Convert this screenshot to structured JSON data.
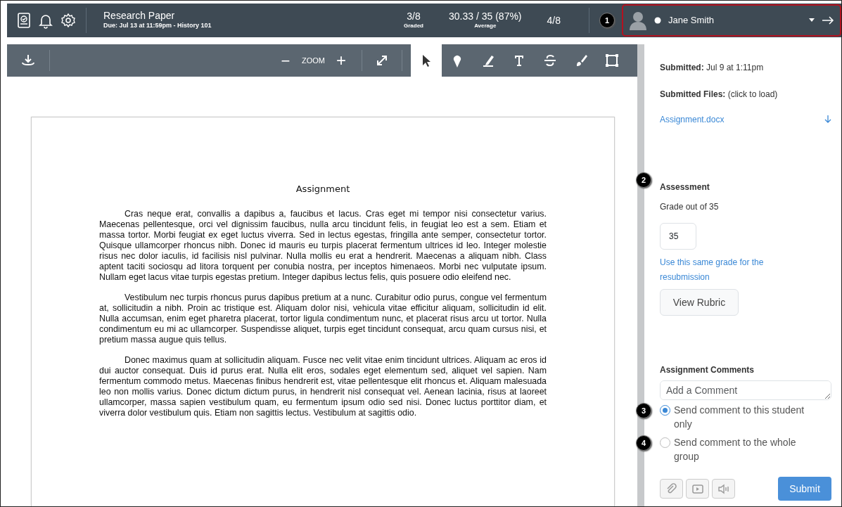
{
  "header": {
    "title": "Research Paper",
    "subtitle": "Due: Jul 13 at 11:59pm - History 101",
    "stats": [
      {
        "value": "3/8",
        "label": "Graded"
      },
      {
        "value": "30.33 / 35 (87%)",
        "label": "Average"
      },
      {
        "value": "4/8"
      }
    ],
    "student": {
      "name": "Jane Smith",
      "callout": "1"
    }
  },
  "toolbar": {
    "zoom_label": "ZOOM",
    "zoom_out": "−",
    "zoom_in": "+",
    "tools": [
      {
        "kind": "pointer",
        "selected": true
      },
      {
        "kind": "pin",
        "selected": false
      },
      {
        "kind": "highlight",
        "selected": false
      },
      {
        "kind": "text",
        "selected": false
      },
      {
        "kind": "strike",
        "selected": false
      },
      {
        "kind": "brush",
        "selected": false
      },
      {
        "kind": "box",
        "selected": false
      }
    ]
  },
  "document": {
    "heading": "Assignment",
    "paragraphs": [
      "Cras neque erat, convallis a dapibus a, faucibus et lacus. Cras eget mi tempor nisi consectetur varius. Maecenas pellentesque, orci vel dignissim faucibus, nulla arcu tincidunt felis, in feugiat leo est a sem. Etiam et massa tortor. Morbi feugiat ex eget luctus viverra. Sed in lectus egestas, fringilla ante semper, consectetur tortor. Quisque ullamcorper rhoncus nibh. Donec id mauris eu turpis placerat fermentum ultrices id leo. Integer molestie risus nec dolor iaculis, id facilisis nisl pulvinar. Nulla mollis eu erat a hendrerit. Maecenas a aliquam nibh. Class aptent taciti sociosqu ad litora torquent per conubia nostra, per inceptos himenaeos. Morbi nec vulputate ipsum. Nullam eget lacus vitae turpis egestas pretium. Integer dapibus lectus felis, quis posuere odio eleifend nec.",
      "Vestibulum nec turpis rhoncus purus dapibus pretium at a nunc. Curabitur odio purus, congue vel fermentum at, sollicitudin a nibh. Proin ac tristique est. Aliquam dolor nisi, vehicula vitae efficitur aliquam, sollicitudin id elit. Nulla accumsan, enim eget pharetra placerat, tortor ligula condimentum nunc, et placerat risus arcu ut tortor. Nulla condimentum eu mi ac ullamcorper. Suspendisse aliquet, turpis eget tincidunt consequat, arcu quam cursus nisi, et pretium massa augue quis tellus.",
      "Donec maximus quam at sollicitudin aliquam. Fusce nec velit vitae enim tincidunt ultrices. Aliquam ac eros id dui auctor consequat. Duis id purus erat. Nulla elit eros, sodales eget elementum sed, aliquet vel sapien. Nam fermentum commodo metus. Maecenas finibus hendrerit est, vitae pellentesque elit rhoncus et. Aliquam malesuada leo non mollis varius. Donec dictum dictum purus, in hendrerit nisl consequat vel. Aenean lacinia, risus at laoreet ullamcorper, massa sapien vestibulum quam, eu fermentum ipsum odio sed nisi. Donec luctus porttitor diam, et viverra dolor vestibulum quis. Etiam non sagittis lectus. Vestibulum at sagittis odio."
    ]
  },
  "sidebar": {
    "submitted": "**Submitted:** Jul 9 at 1:11pm",
    "files_label": "**Submitted Files:** (click to load)",
    "file": "Assignment.docx",
    "assessment": {
      "title": "Assessment",
      "callout": "2",
      "grade_label": "Grade out of 35",
      "grade": "35",
      "link": "Use this same grade for the resubmission",
      "rubric_button": "View Rubric"
    },
    "comments": {
      "title": "Assignment Comments",
      "placeholder": "Add a Comment",
      "options": [
        {
          "label": "Send comment to this student only",
          "selected": true,
          "callout": "3"
        },
        {
          "label": "Send comment to the whole group",
          "selected": false,
          "callout": "4"
        }
      ]
    },
    "submit": "Submit"
  }
}
